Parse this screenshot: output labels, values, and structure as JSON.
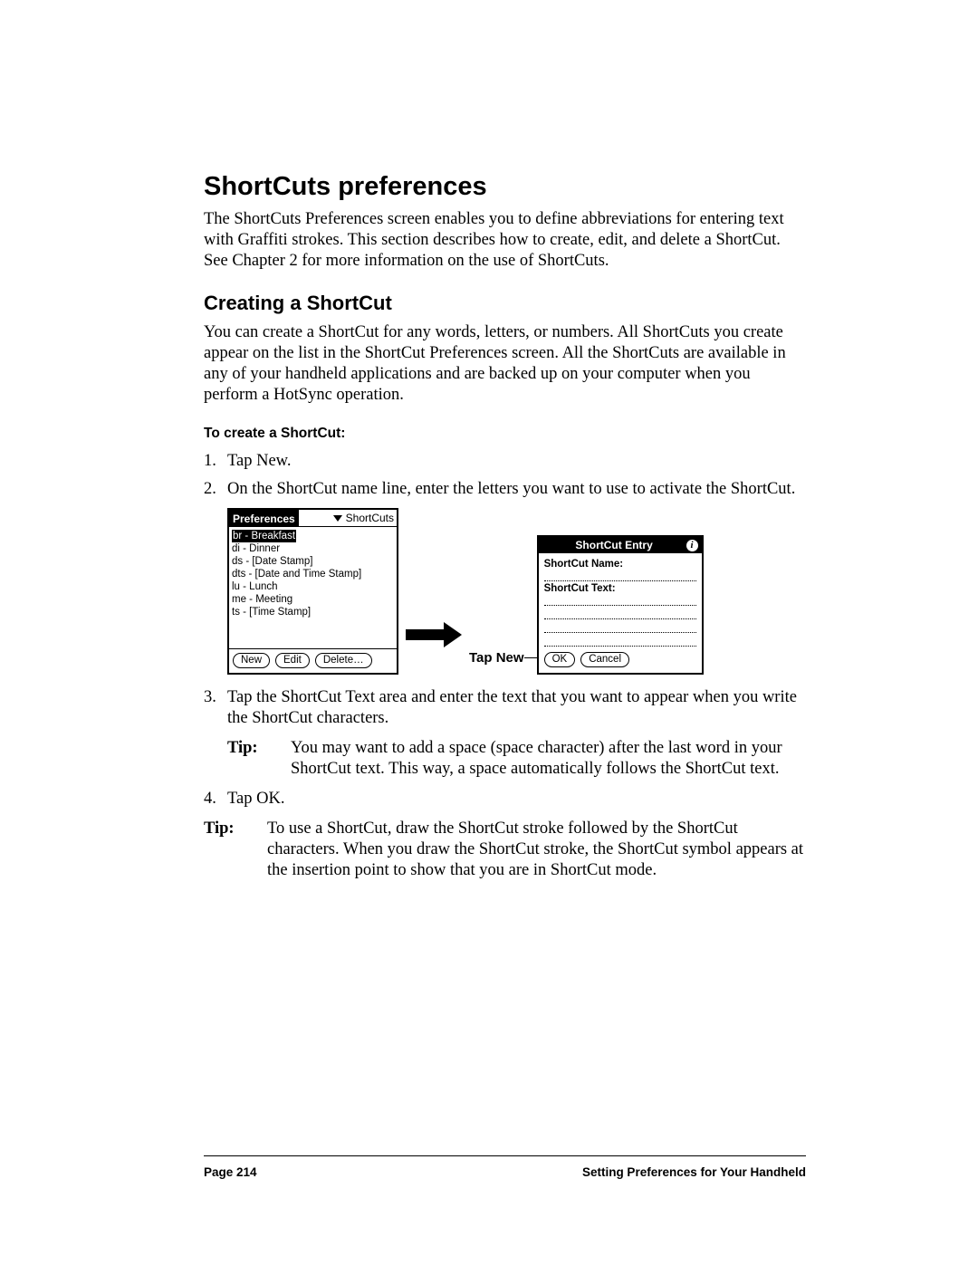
{
  "heading1": "ShortCuts preferences",
  "intro": "The ShortCuts Preferences screen enables you to define abbreviations for entering text with Graffiti strokes. This section describes how to create, edit, and delete a ShortCut. See Chapter 2 for more information on the use of ShortCuts.",
  "heading2": "Creating a ShortCut",
  "create_intro": "You can create a ShortCut for any words, letters, or numbers. All ShortCuts you create appear on the list in the ShortCut Preferences screen. All the ShortCuts are available in any of your handheld applications and are backed up on your computer when you perform a HotSync operation.",
  "procedure_title": "To create a ShortCut:",
  "steps": {
    "s1": "Tap New.",
    "s2": "On the ShortCut name line, enter the letters you want to use to activate the ShortCut.",
    "s3": "Tap the ShortCut Text area and enter the text that you want to appear when you write the ShortCut characters.",
    "s4": "Tap OK."
  },
  "tip_label": "Tip:",
  "tip1": "You may want to add a space (space character) after the last word in your ShortCut text. This way, a space automatically follows the ShortCut text.",
  "tip2": "To use a ShortCut, draw the ShortCut stroke followed by the ShortCut characters. When you draw the ShortCut stroke, the ShortCut symbol appears at the insertion point to show that you are in ShortCut mode.",
  "figure": {
    "left": {
      "title": "Preferences",
      "picker": "ShortCuts",
      "items": [
        "br - Breakfast",
        "di - Dinner",
        "ds - [Date Stamp]",
        "dts - [Date and Time Stamp]",
        "lu - Lunch",
        "me - Meeting",
        "ts - [Time Stamp]"
      ],
      "btn_new": "New",
      "btn_edit": "Edit",
      "btn_delete": "Delete…"
    },
    "callout": "Tap New",
    "right": {
      "title": "ShortCut Entry",
      "label_name": "ShortCut Name:",
      "label_text": "ShortCut Text:",
      "btn_ok": "OK",
      "btn_cancel": "Cancel"
    }
  },
  "footer": {
    "page": "Page 214",
    "section": "Setting Preferences for Your Handheld"
  }
}
